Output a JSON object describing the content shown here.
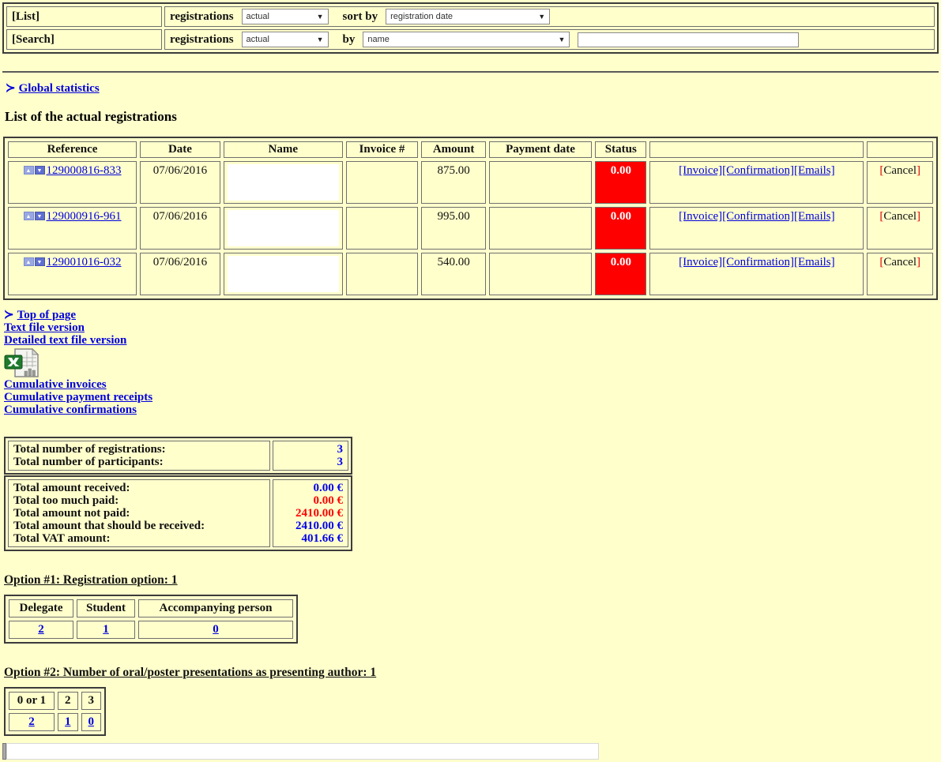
{
  "colors": {
    "background": "#ffffcc",
    "link_blue": "#0000dd",
    "status_bg": "#ff0000",
    "status_text": "#ffffff",
    "value_blue": "#0000ee",
    "value_red": "#ff0000"
  },
  "icons": {
    "dropdown_arrow": "▼",
    "sort_up": "▲",
    "sort_down": "▼",
    "arrow_prefix": "≻"
  },
  "toolbar": {
    "list_label": "[List]",
    "search_label": "[Search]",
    "registrations_label": "registrations",
    "list_type_value": "actual",
    "sort_by_label": "sort by",
    "sort_value": "registration date",
    "search_type_value": "actual",
    "by_label": "by",
    "search_field_value": "name",
    "search_input_value": ""
  },
  "nav": {
    "global_statistics": "Global statistics"
  },
  "page": {
    "title": "List of the actual registrations"
  },
  "registrations_table": {
    "headers": [
      "Reference",
      "Date",
      "Name",
      "Invoice #",
      "Amount",
      "Payment date",
      "Status",
      "",
      ""
    ],
    "actions": {
      "invoice": "[Invoice]",
      "confirmation": "[Confirmation]",
      "emails": "[Emails]",
      "cancel_open": "[",
      "cancel_label": "Cancel",
      "cancel_close": "]"
    },
    "rows": [
      {
        "reference": "129000816-833",
        "date": "07/06/2016",
        "invoice": "",
        "amount": "875.00",
        "payment_date": "",
        "status": "0.00"
      },
      {
        "reference": "129000916-961",
        "date": "07/06/2016",
        "invoice": "",
        "amount": "995.00",
        "payment_date": "",
        "status": "0.00"
      },
      {
        "reference": "129001016-032",
        "date": "07/06/2016",
        "invoice": "",
        "amount": "540.00",
        "payment_date": "",
        "status": "0.00"
      }
    ]
  },
  "footer_links": {
    "top_of_page": "Top of page",
    "text_file": "Text file version",
    "detailed_text_file": "Detailed text file version",
    "cumulative_invoices": "Cumulative invoices",
    "cumulative_receipts": "Cumulative payment receipts",
    "cumulative_confirmations": "Cumulative confirmations"
  },
  "totals_counts": {
    "labels": [
      "Total number of registrations:",
      "Total number of participants:"
    ],
    "values": [
      "3",
      "3"
    ],
    "value_colors": [
      "#0000ee",
      "#0000ee"
    ]
  },
  "totals_amounts": {
    "labels": [
      "Total amount received:",
      "Total too much paid:",
      "Total amount not paid:",
      "Total amount that should be received:",
      "Total VAT amount:"
    ],
    "values": [
      "0.00 €",
      "0.00 €",
      "2410.00 €",
      "2410.00 €",
      "401.66 €"
    ],
    "value_colors": [
      "#0000ee",
      "#ff0000",
      "#ff0000",
      "#0000ee",
      "#0000ee"
    ]
  },
  "option1": {
    "heading": "Option #1: Registration option: 1",
    "headers": [
      "Delegate",
      "Student",
      "Accompanying person"
    ],
    "values": [
      "2",
      "1",
      "0"
    ]
  },
  "option2": {
    "heading": "Option #2: Number of oral/poster presentations as presenting author: 1",
    "headers": [
      "0 or 1",
      "2",
      "3"
    ],
    "values": [
      "2",
      "1",
      "0"
    ]
  },
  "bottom": {
    "input_value": ""
  }
}
